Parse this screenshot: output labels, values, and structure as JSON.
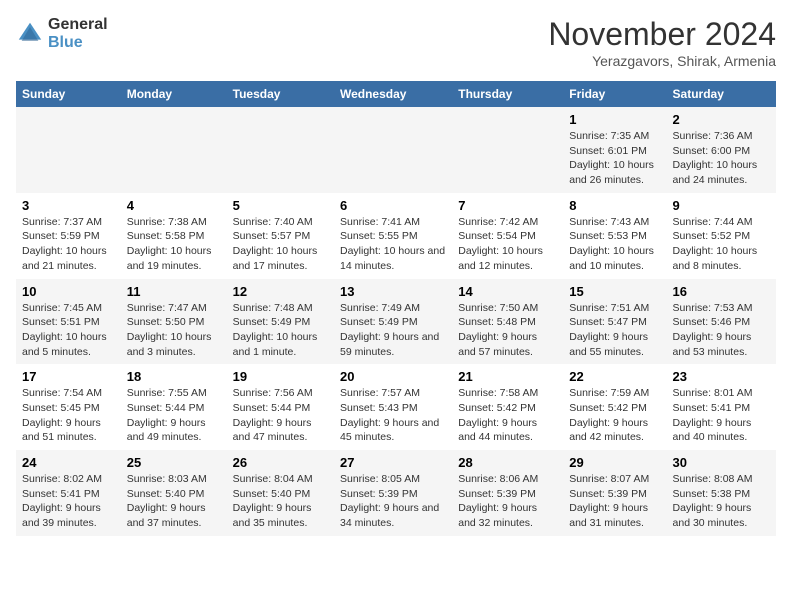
{
  "logo": {
    "general": "General",
    "blue": "Blue"
  },
  "header": {
    "month": "November 2024",
    "location": "Yerazgavors, Shirak, Armenia"
  },
  "weekdays": [
    "Sunday",
    "Monday",
    "Tuesday",
    "Wednesday",
    "Thursday",
    "Friday",
    "Saturday"
  ],
  "weeks": [
    [
      {
        "day": "",
        "info": ""
      },
      {
        "day": "",
        "info": ""
      },
      {
        "day": "",
        "info": ""
      },
      {
        "day": "",
        "info": ""
      },
      {
        "day": "",
        "info": ""
      },
      {
        "day": "1",
        "info": "Sunrise: 7:35 AM\nSunset: 6:01 PM\nDaylight: 10 hours and 26 minutes."
      },
      {
        "day": "2",
        "info": "Sunrise: 7:36 AM\nSunset: 6:00 PM\nDaylight: 10 hours and 24 minutes."
      }
    ],
    [
      {
        "day": "3",
        "info": "Sunrise: 7:37 AM\nSunset: 5:59 PM\nDaylight: 10 hours and 21 minutes."
      },
      {
        "day": "4",
        "info": "Sunrise: 7:38 AM\nSunset: 5:58 PM\nDaylight: 10 hours and 19 minutes."
      },
      {
        "day": "5",
        "info": "Sunrise: 7:40 AM\nSunset: 5:57 PM\nDaylight: 10 hours and 17 minutes."
      },
      {
        "day": "6",
        "info": "Sunrise: 7:41 AM\nSunset: 5:55 PM\nDaylight: 10 hours and 14 minutes."
      },
      {
        "day": "7",
        "info": "Sunrise: 7:42 AM\nSunset: 5:54 PM\nDaylight: 10 hours and 12 minutes."
      },
      {
        "day": "8",
        "info": "Sunrise: 7:43 AM\nSunset: 5:53 PM\nDaylight: 10 hours and 10 minutes."
      },
      {
        "day": "9",
        "info": "Sunrise: 7:44 AM\nSunset: 5:52 PM\nDaylight: 10 hours and 8 minutes."
      }
    ],
    [
      {
        "day": "10",
        "info": "Sunrise: 7:45 AM\nSunset: 5:51 PM\nDaylight: 10 hours and 5 minutes."
      },
      {
        "day": "11",
        "info": "Sunrise: 7:47 AM\nSunset: 5:50 PM\nDaylight: 10 hours and 3 minutes."
      },
      {
        "day": "12",
        "info": "Sunrise: 7:48 AM\nSunset: 5:49 PM\nDaylight: 10 hours and 1 minute."
      },
      {
        "day": "13",
        "info": "Sunrise: 7:49 AM\nSunset: 5:49 PM\nDaylight: 9 hours and 59 minutes."
      },
      {
        "day": "14",
        "info": "Sunrise: 7:50 AM\nSunset: 5:48 PM\nDaylight: 9 hours and 57 minutes."
      },
      {
        "day": "15",
        "info": "Sunrise: 7:51 AM\nSunset: 5:47 PM\nDaylight: 9 hours and 55 minutes."
      },
      {
        "day": "16",
        "info": "Sunrise: 7:53 AM\nSunset: 5:46 PM\nDaylight: 9 hours and 53 minutes."
      }
    ],
    [
      {
        "day": "17",
        "info": "Sunrise: 7:54 AM\nSunset: 5:45 PM\nDaylight: 9 hours and 51 minutes."
      },
      {
        "day": "18",
        "info": "Sunrise: 7:55 AM\nSunset: 5:44 PM\nDaylight: 9 hours and 49 minutes."
      },
      {
        "day": "19",
        "info": "Sunrise: 7:56 AM\nSunset: 5:44 PM\nDaylight: 9 hours and 47 minutes."
      },
      {
        "day": "20",
        "info": "Sunrise: 7:57 AM\nSunset: 5:43 PM\nDaylight: 9 hours and 45 minutes."
      },
      {
        "day": "21",
        "info": "Sunrise: 7:58 AM\nSunset: 5:42 PM\nDaylight: 9 hours and 44 minutes."
      },
      {
        "day": "22",
        "info": "Sunrise: 7:59 AM\nSunset: 5:42 PM\nDaylight: 9 hours and 42 minutes."
      },
      {
        "day": "23",
        "info": "Sunrise: 8:01 AM\nSunset: 5:41 PM\nDaylight: 9 hours and 40 minutes."
      }
    ],
    [
      {
        "day": "24",
        "info": "Sunrise: 8:02 AM\nSunset: 5:41 PM\nDaylight: 9 hours and 39 minutes."
      },
      {
        "day": "25",
        "info": "Sunrise: 8:03 AM\nSunset: 5:40 PM\nDaylight: 9 hours and 37 minutes."
      },
      {
        "day": "26",
        "info": "Sunrise: 8:04 AM\nSunset: 5:40 PM\nDaylight: 9 hours and 35 minutes."
      },
      {
        "day": "27",
        "info": "Sunrise: 8:05 AM\nSunset: 5:39 PM\nDaylight: 9 hours and 34 minutes."
      },
      {
        "day": "28",
        "info": "Sunrise: 8:06 AM\nSunset: 5:39 PM\nDaylight: 9 hours and 32 minutes."
      },
      {
        "day": "29",
        "info": "Sunrise: 8:07 AM\nSunset: 5:39 PM\nDaylight: 9 hours and 31 minutes."
      },
      {
        "day": "30",
        "info": "Sunrise: 8:08 AM\nSunset: 5:38 PM\nDaylight: 9 hours and 30 minutes."
      }
    ]
  ]
}
